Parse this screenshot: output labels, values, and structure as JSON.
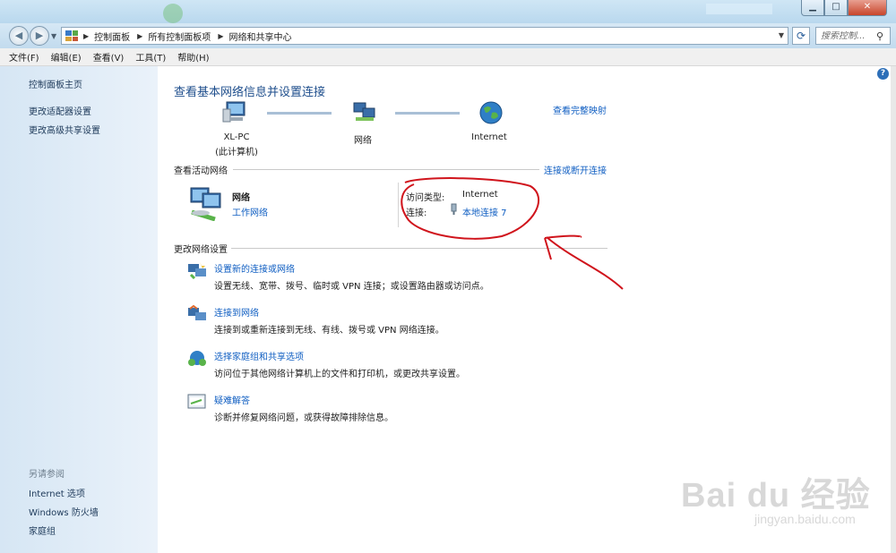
{
  "window": {
    "min_label": "▁",
    "max_label": "□",
    "close_label": "✕"
  },
  "address": {
    "crumbs": [
      "控制面板",
      "所有控制面板项",
      "网络和共享中心"
    ],
    "search_placeholder": "搜索控制... "
  },
  "menu": [
    "文件(F)",
    "编辑(E)",
    "查看(V)",
    "工具(T)",
    "帮助(H)"
  ],
  "sidebar": {
    "links": [
      "控制面板主页",
      "更改适配器设置",
      "更改高级共享设置"
    ],
    "see_also_label": "另请参阅",
    "see_also": [
      "Internet 选项",
      "Windows 防火墙",
      "家庭组"
    ]
  },
  "main": {
    "title": "查看基本网络信息并设置连接",
    "view_full_map": "查看完整映射",
    "map": {
      "pc_name": "XL-PC",
      "pc_sub": "(此计算机)",
      "network": "网络",
      "internet": "Internet"
    },
    "active_section": "查看活动网络",
    "connect_disconnect": "连接或断开连接",
    "active_network": {
      "name": "网络",
      "type": "工作网络",
      "access_type_label": "访问类型:",
      "access_type_value": "Internet",
      "connection_label": "连接:",
      "connection_value": "本地连接 7"
    },
    "change_section": "更改网络设置",
    "tasks": [
      {
        "title": "设置新的连接或网络",
        "desc": "设置无线、宽带、拨号、临时或 VPN 连接；或设置路由器或访问点。"
      },
      {
        "title": "连接到网络",
        "desc": "连接到或重新连接到无线、有线、拨号或 VPN 网络连接。"
      },
      {
        "title": "选择家庭组和共享选项",
        "desc": "访问位于其他网络计算机上的文件和打印机，或更改共享设置。"
      },
      {
        "title": "疑难解答",
        "desc": "诊断并修复网络问题，或获得故障排除信息。"
      }
    ]
  },
  "watermark": {
    "brand": "Bai du 经验",
    "url": "jingyan.baidu.com"
  },
  "colors": {
    "link": "#0f5ec2",
    "title": "#1e4e8c",
    "annotation": "#d0141c"
  }
}
